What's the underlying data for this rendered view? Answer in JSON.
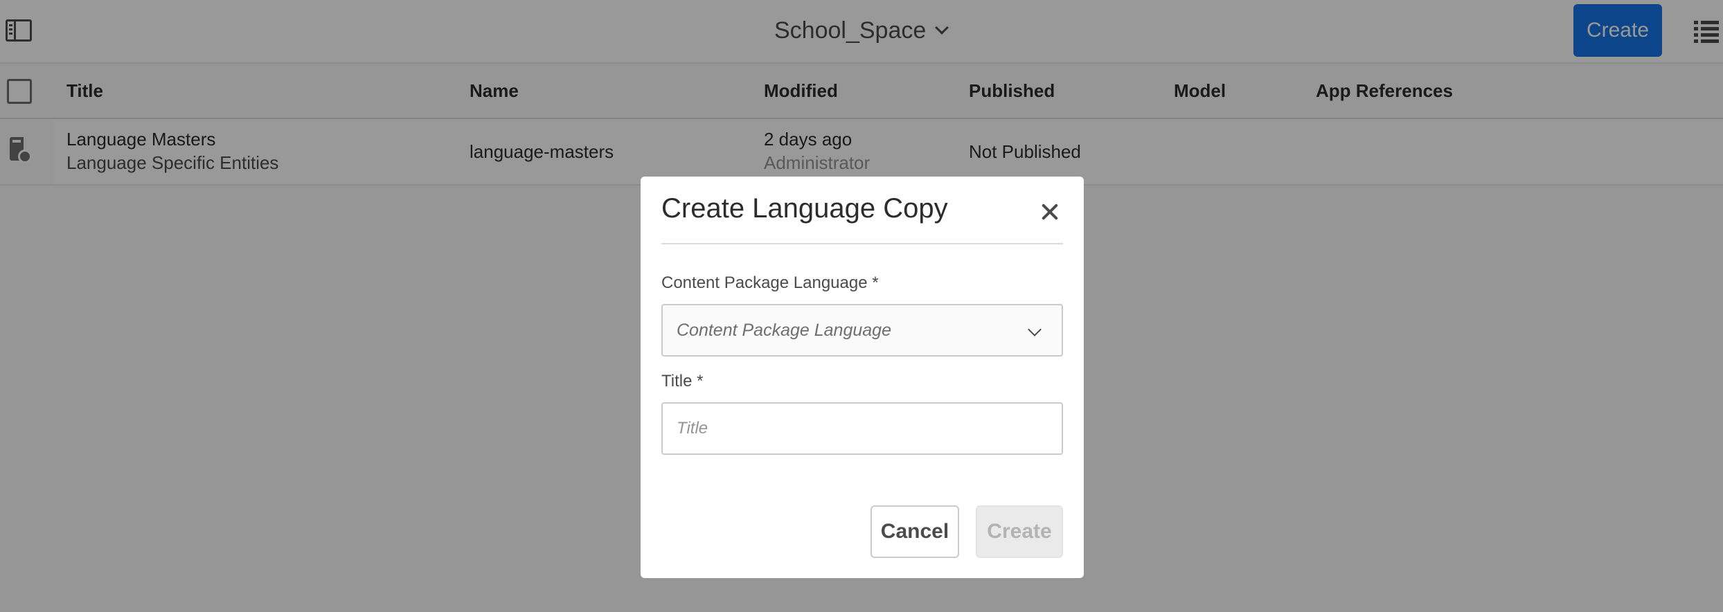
{
  "header": {
    "title": "School_Space",
    "create_label": "Create"
  },
  "table": {
    "columns": [
      "Title",
      "Name",
      "Modified",
      "Published",
      "Model",
      "App References"
    ],
    "rows": [
      {
        "title": "Language Masters",
        "subtitle": "Language Specific Entities",
        "name": "language-masters",
        "modified": "2 days ago",
        "modified_by": "Administrator",
        "published": "Not Published"
      }
    ]
  },
  "dialog": {
    "title": "Create Language Copy",
    "language_label": "Content Package Language *",
    "language_placeholder": "Content Package Language",
    "title_label": "Title *",
    "title_placeholder": "Title",
    "cancel_label": "Cancel",
    "create_label": "Create"
  },
  "icons": {
    "rail_toggle": "rail-toggle-icon",
    "dropdown": "chevron-down-icon",
    "view": "list-view-icon",
    "row_type": "language-master-icon",
    "close": "close-icon"
  },
  "colors": {
    "primary_button": "#1473e6",
    "overlay": "rgba(0,0,0,0.4)"
  }
}
